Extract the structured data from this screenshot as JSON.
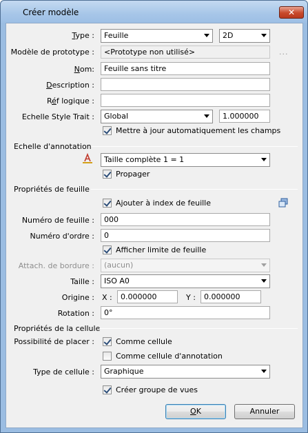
{
  "window": {
    "title": "Créer modèle",
    "close_glyph": "✕"
  },
  "general": {
    "type_label": "Type :",
    "type_value": "Feuille",
    "dim_value": "2D",
    "prototype_label": "Modèle de prototype :",
    "prototype_value": "<Prototype non utilisé>",
    "prototype_ellipsis": "...",
    "name_label": "Nom:",
    "name_value": "Feuille sans titre",
    "description_label": "Description :",
    "description_value": "",
    "logical_label": "Réf logique :",
    "logical_value": "",
    "line_scale_label": "Echelle Style Trait :",
    "line_scale_value": "Global",
    "line_scale_factor": "1.000000",
    "auto_update_label": "Mettre à jour automatiquement les champs",
    "auto_update_checked": true
  },
  "annotation": {
    "group_label": "Echelle d'annotation",
    "icon": "annotation-scale-icon",
    "scale_value": "Taille complète 1 = 1",
    "propagate_label": "Propager",
    "propagate_checked": true
  },
  "sheet": {
    "group_label": "Propriétés de feuille",
    "add_index_label": "Ajouter à index de feuille",
    "add_index_checked": true,
    "index_icon": "sheet-index-icon",
    "sheet_number_label": "Numéro de feuille :",
    "sheet_number_value": "000",
    "order_label": "Numéro d'ordre :",
    "order_value": "0",
    "show_boundary_label": "Afficher limite de feuille",
    "show_boundary_checked": true,
    "border_attach_label": "Attach. de bordure :",
    "border_attach_value": "(aucun)",
    "size_label": "Taille :",
    "size_value": "ISO A0",
    "origin_label": "Origine :",
    "origin_x_label": "X :",
    "origin_x_value": "0.000000",
    "origin_y_label": "Y :",
    "origin_y_value": "0.000000",
    "rotation_label": "Rotation :",
    "rotation_value": "0°"
  },
  "cell": {
    "group_label": "Propriétés de la cellule",
    "placement_label": "Possibilité de placer :",
    "as_cell_label": "Comme cellule",
    "as_cell_checked": true,
    "as_annotation_cell_label": "Comme cellule d'annotation",
    "as_annotation_cell_checked": false,
    "cell_type_label": "Type de cellule :",
    "cell_type_value": "Graphique",
    "view_group_label": "Créer groupe de vues",
    "view_group_checked": true
  },
  "buttons": {
    "ok_label": "OK",
    "cancel_label": "Annuler"
  }
}
